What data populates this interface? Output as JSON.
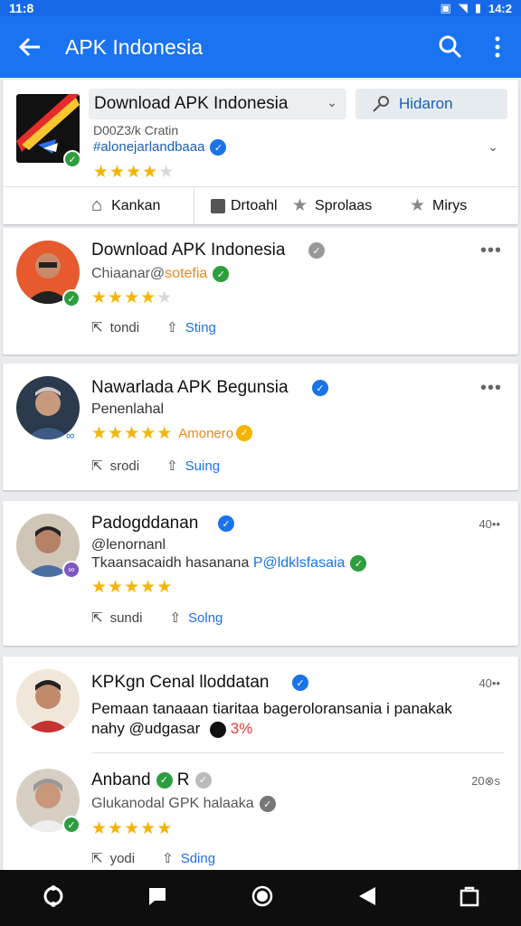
{
  "status_bar": {
    "time_left": "11:8",
    "time_right": "14:2"
  },
  "app_bar": {
    "title": "APK Indonesia"
  },
  "header": {
    "dropdown_label": "Download APK Indonesia",
    "button_label": "Hidaron",
    "subtitle": "D00Z3/k Cratin",
    "handle": "#alonejarlandbaaa",
    "rating": 4,
    "tabs": [
      "Kankan",
      "Drtoahl",
      "Sprolaas",
      "Mirys"
    ]
  },
  "posts": [
    {
      "name": "Download APK Indonesia",
      "sub": "Chiaanar@",
      "sub_accent": "sotefia",
      "rating": 4,
      "actions": [
        "tondi",
        "Sting"
      ],
      "time": "",
      "more": "•••"
    },
    {
      "name": "Nawarlada APK Begunsia",
      "sub": "Penenlahal",
      "rating": 4.5,
      "rating_label": "Amonero",
      "actions": [
        "srodi",
        "Suing"
      ],
      "time": "",
      "more": "•••"
    },
    {
      "name": "Padogddanan",
      "sub": "@lenornanl",
      "body": "Tkaansacaidh hasanana",
      "body_link": "P@ldklsfasaia",
      "rating": 5,
      "actions": [
        "sundi",
        "Solng"
      ],
      "time": "40••",
      "more": ""
    },
    {
      "name": "KPKgn Cenal lloddatan",
      "body": "Pemaan tanaaan tiaritaa bageroloransania i panakak",
      "body2": "nahy @udgasar",
      "body2_accent": "3%",
      "time": "40••"
    },
    {
      "name": "Anband",
      "name_suffix": "R",
      "sub": "Glukanodal GPK halaaka",
      "rating": 4.5,
      "actions": [
        "yodi",
        "Sding"
      ],
      "time": "20⊗s"
    }
  ],
  "colors": {
    "primary": "#1a73f0",
    "star": "#f5b400",
    "verified_blue": "#1a73e8",
    "green": "#2e9d3e"
  }
}
